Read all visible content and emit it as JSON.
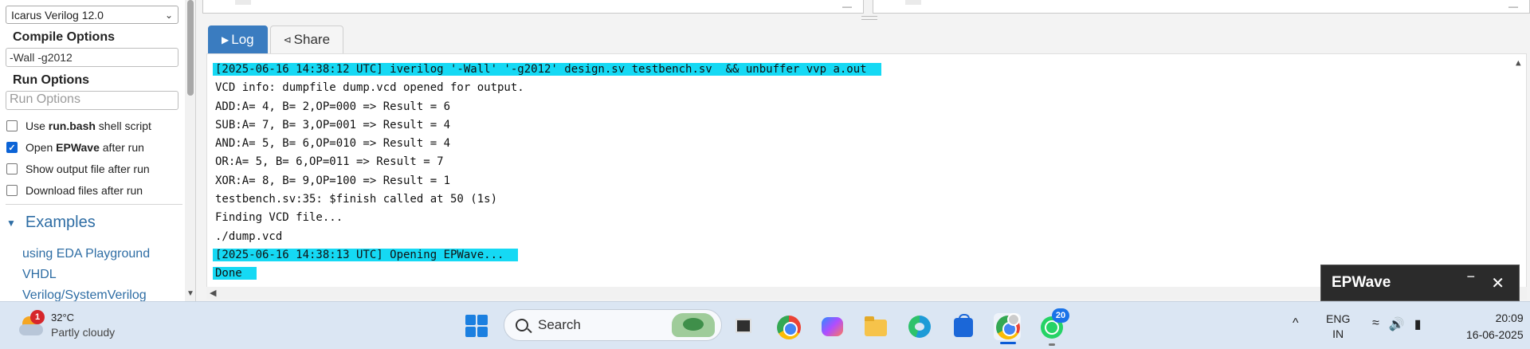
{
  "sidebar": {
    "simulator_select": "Icarus Verilog 12.0",
    "compile_options_label": "Compile Options",
    "compile_options_value": "-Wall -g2012",
    "run_options_label": "Run Options",
    "run_options_placeholder": "Run Options",
    "checkboxes": [
      {
        "label_pre": "Use ",
        "label_bold": "run.bash",
        "label_post": " shell script",
        "checked": false
      },
      {
        "label_pre": "Open ",
        "label_bold": "EPWave",
        "label_post": " after run",
        "checked": true
      },
      {
        "label_pre": "Show output file after run",
        "label_bold": "",
        "label_post": "",
        "checked": false
      },
      {
        "label_pre": "Download files after run",
        "label_bold": "",
        "label_post": "",
        "checked": false
      }
    ],
    "examples_heading": "Examples",
    "example_links": [
      "using EDA Playground",
      "VHDL",
      "Verilog/SystemVerilog"
    ]
  },
  "tabs": [
    {
      "icon": "play-circle-icon",
      "label": "Log",
      "active": true
    },
    {
      "icon": "share-icon",
      "label": "Share",
      "active": false
    }
  ],
  "log": {
    "lines": [
      {
        "text": "[2025-06-16 14:38:12 UTC] iverilog '-Wall' '-g2012' design.sv testbench.sv  && unbuffer vvp a.out",
        "highlight": true
      },
      {
        "text": "VCD info: dumpfile dump.vcd opened for output.",
        "highlight": false
      },
      {
        "text": "ADD:A= 4, B= 2,OP=000 => Result = 6",
        "highlight": false
      },
      {
        "text": "SUB:A= 7, B= 3,OP=001 => Result = 4",
        "highlight": false
      },
      {
        "text": "AND:A= 5, B= 6,OP=010 => Result = 4",
        "highlight": false
      },
      {
        "text": "OR:A= 5, B= 6,OP=011 => Result = 7",
        "highlight": false
      },
      {
        "text": "XOR:A= 8, B= 9,OP=100 => Result = 1",
        "highlight": false
      },
      {
        "text": "testbench.sv:35: $finish called at 50 (1s)",
        "highlight": false
      },
      {
        "text": "Finding VCD file...",
        "highlight": false
      },
      {
        "text": "./dump.vcd",
        "highlight": false
      },
      {
        "text": "[2025-06-16 14:38:13 UTC] Opening EPWave...",
        "highlight": true
      },
      {
        "text": "Done",
        "highlight": true
      }
    ],
    "highlight_color": "#15d9f4"
  },
  "epwave_popup": {
    "title": "EPWave",
    "minimize": "−",
    "close": "✕"
  },
  "taskbar": {
    "weather_temp": "32°C",
    "weather_desc": "Partly cloudy",
    "weather_badge": "1",
    "search_label": "Search",
    "whatsapp_badge": "20",
    "tray_chevron": "^",
    "lang_line1": "ENG",
    "lang_line2": "IN",
    "time": "20:09",
    "date": "16-06-2025"
  },
  "colors": {
    "accent_blue": "#3a7cc0",
    "link_blue": "#2e6da4",
    "checkbox_blue": "#0b63d6"
  }
}
